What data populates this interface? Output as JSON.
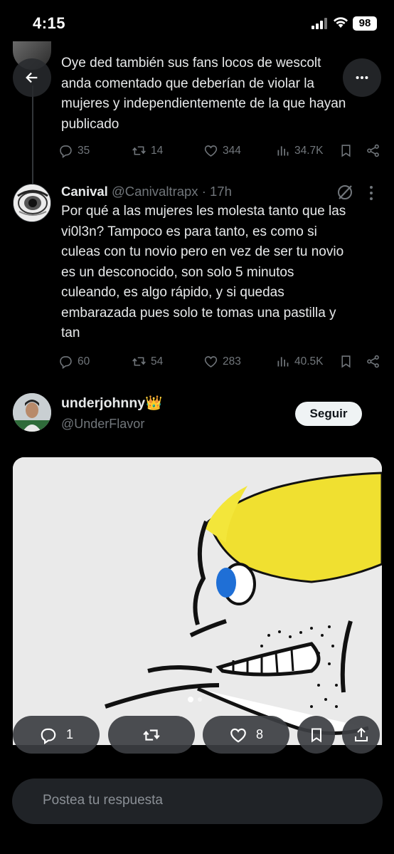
{
  "status_bar": {
    "time": "4:15",
    "battery": "98"
  },
  "tweets": [
    {
      "text": "Oye ded también sus fans locos de wescolt\nanda comentado que deberían de violar la\nmujeres y independientemente de la que hayan\npublicado",
      "stats": {
        "replies": "35",
        "retweets": "14",
        "likes": "344",
        "views": "34.7K"
      }
    },
    {
      "name": "Canival",
      "handle": "@Canivaltrapx",
      "time": "· 17h",
      "text": "Por qué a las mujeres les molesta tanto que las\nvi0l3n? Tampoco es para tanto, es como si\nculeas con tu novio pero en vez de ser tu novio\nes un desconocido, son solo 5 minutos\nculeando, es algo rápido, y si quedas\nembarazada pues solo te tomas una pastilla y\ntan",
      "stats": {
        "replies": "60",
        "retweets": "54",
        "likes": "283",
        "views": "40.5K"
      }
    }
  ],
  "main_post": {
    "name": "underjohnny",
    "crown": "👑",
    "handle": "@UnderFlavor",
    "follow_label": "Seguir",
    "stats": {
      "replies": "1",
      "likes": "8"
    }
  },
  "reply_bar": {
    "placeholder": "Postea tu respuesta"
  },
  "colors": {
    "background": "#000000",
    "text": "#e7e9ea",
    "muted": "#71767b",
    "pill": "#3c3e42"
  },
  "icons": [
    "back-arrow-icon",
    "more-icon",
    "reply-icon",
    "retweet-icon",
    "like-icon",
    "views-icon",
    "bookmark-icon",
    "share-icon",
    "grok-icon",
    "upload-icon"
  ]
}
